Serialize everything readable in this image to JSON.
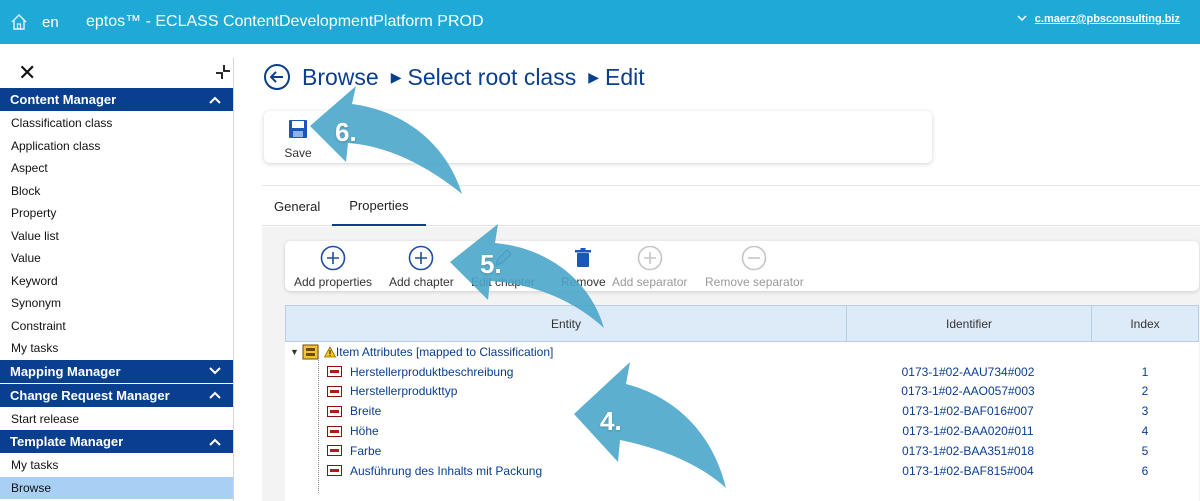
{
  "topbar": {
    "lang": "en",
    "title": "eptos™ - ECLASS ContentDevelopmentPlatform PROD",
    "user": "c.maerz@pbsconsulting.biz"
  },
  "sidebar": {
    "sections": [
      {
        "label": "Content Manager",
        "items": [
          "Classification class",
          "Application class",
          "Aspect",
          "Block",
          "Property",
          "Value list",
          "Value",
          "Keyword",
          "Synonym",
          "Constraint",
          "My tasks"
        ]
      },
      {
        "label": "Mapping Manager"
      },
      {
        "label": "Change Request Manager",
        "items": [
          "Start release"
        ]
      },
      {
        "label": "Template Manager",
        "items": [
          "My tasks",
          "Browse"
        ]
      }
    ]
  },
  "breadcrumb": {
    "p1": "Browse",
    "p2": "Select root class",
    "p3": "Edit"
  },
  "save_label": "Save",
  "tabs": {
    "general": "General",
    "properties": "Properties"
  },
  "toolbar": {
    "add_properties": "Add properties",
    "add_chapter": "Add chapter",
    "edit_chapter": "Edit chapter",
    "remove": "Remove",
    "add_separator": "Add separator",
    "remove_separator": "Remove separator"
  },
  "grid": {
    "headers": {
      "entity": "Entity",
      "identifier": "Identifier",
      "index": "Index"
    },
    "root": "Item Attributes [mapped to Classification]",
    "rows": [
      {
        "entity": "Herstellerproduktbeschreibung",
        "identifier": "0173-1#02-AAU734#002",
        "index": "1"
      },
      {
        "entity": "Herstellerprodukttyp",
        "identifier": "0173-1#02-AAO057#003",
        "index": "2"
      },
      {
        "entity": "Breite",
        "identifier": "0173-1#02-BAF016#007",
        "index": "3"
      },
      {
        "entity": "Höhe",
        "identifier": "0173-1#02-BAA020#011",
        "index": "4"
      },
      {
        "entity": "Farbe",
        "identifier": "0173-1#02-BAA351#018",
        "index": "5"
      },
      {
        "entity": "Ausführung des Inhalts mit Packung",
        "identifier": "0173-1#02-BAF815#004",
        "index": "6"
      }
    ]
  },
  "steps": {
    "s4": "4.",
    "s5": "5.",
    "s6": "6."
  },
  "colors": {
    "topbar": "#1fa9d6",
    "navy": "#0a3e8f",
    "arrow": "#4aa6c9",
    "active_nav": "#a8d0f5"
  }
}
